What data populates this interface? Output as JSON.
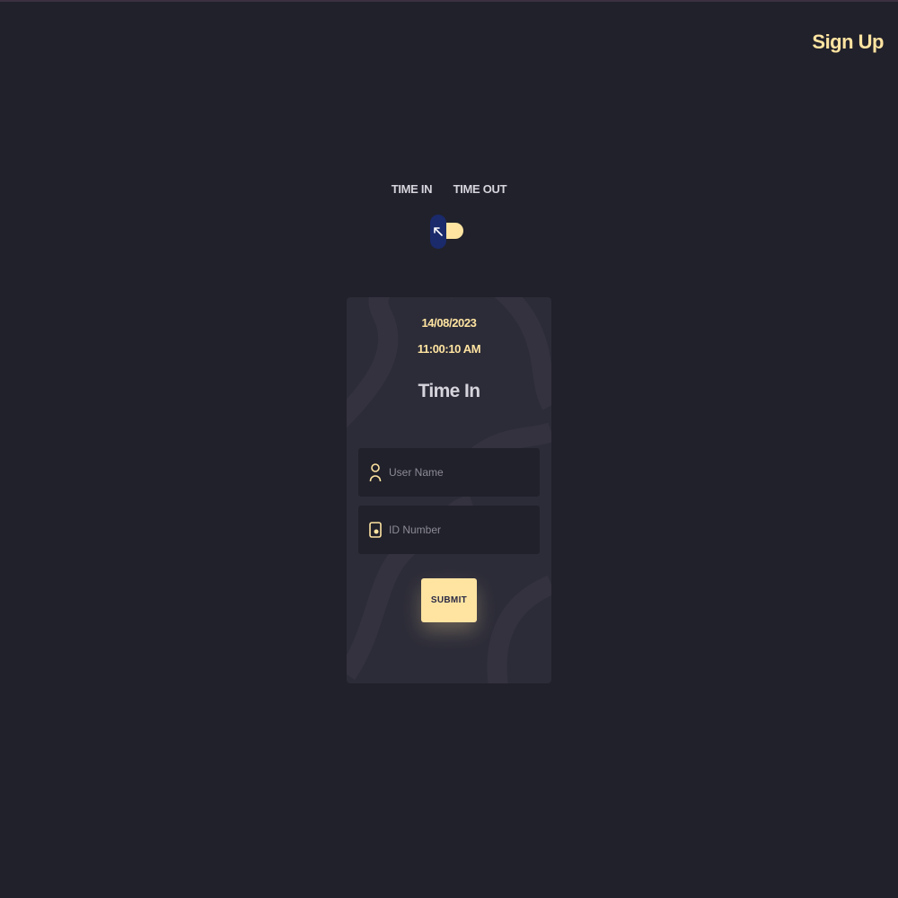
{
  "header": {
    "signup_label": "Sign Up"
  },
  "toggle": {
    "left_label": "TIME IN",
    "right_label": "TIME OUT"
  },
  "card": {
    "date": "14/08/2023",
    "time": "11:00:10 AM",
    "title": "Time In",
    "username_placeholder": "User Name",
    "id_placeholder": "ID Number",
    "submit_label": "SUBMIT"
  },
  "colors": {
    "background": "#21212b",
    "card": "#2c2c38",
    "accent": "#ffe4a1",
    "knob": "#1a2a6b",
    "text_light": "#d6d4dc"
  },
  "icons": {
    "toggle_knob": "arrow-up-left-icon",
    "username": "user-icon",
    "id_number": "id-card-icon"
  }
}
